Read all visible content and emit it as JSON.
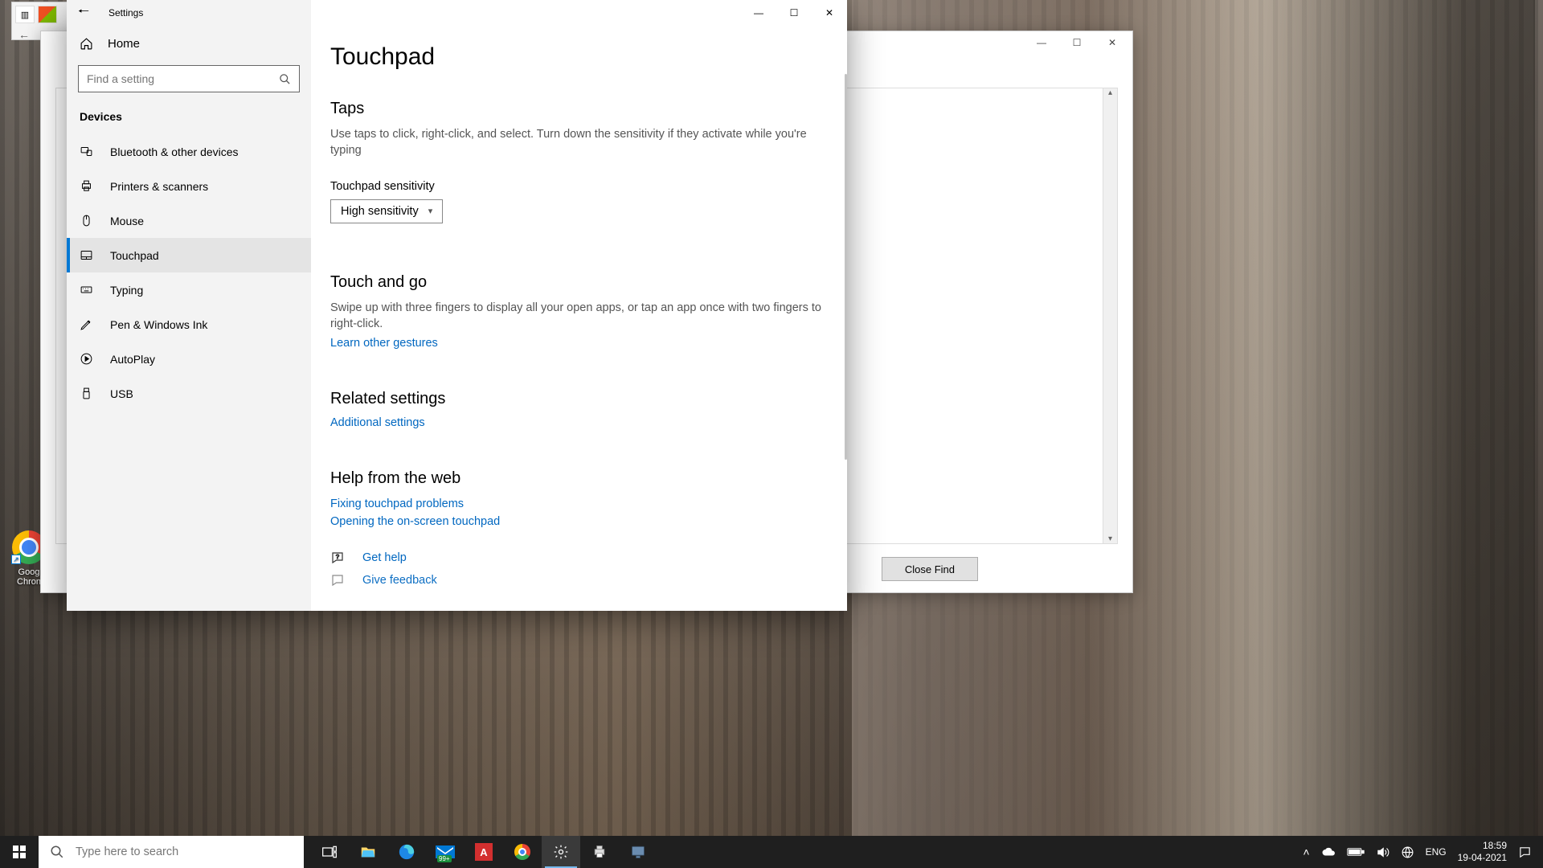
{
  "desktop": {
    "chrome_label_1": "Goog",
    "chrome_label_2": "Chron"
  },
  "bg_window": {
    "close_find": "Close Find"
  },
  "settings": {
    "title": "Settings",
    "home": "Home",
    "search_placeholder": "Find a setting",
    "section": "Devices",
    "items": [
      {
        "label": "Bluetooth & other devices"
      },
      {
        "label": "Printers & scanners"
      },
      {
        "label": "Mouse"
      },
      {
        "label": "Touchpad"
      },
      {
        "label": "Typing"
      },
      {
        "label": "Pen & Windows Ink"
      },
      {
        "label": "AutoPlay"
      },
      {
        "label": "USB"
      }
    ],
    "page": {
      "title": "Touchpad",
      "taps_h": "Taps",
      "taps_p": "Use taps to click, right-click, and select. Turn down the sensitivity if they activate while you're typing",
      "sensitivity_label": "Touchpad sensitivity",
      "sensitivity_value": "High sensitivity",
      "touchgo_h": "Touch and go",
      "touchgo_p": "Swipe up with three fingers to display all your open apps, or tap an app once with two fingers to right-click.",
      "learn_link": "Learn other gestures",
      "related_h": "Related settings",
      "additional_link": "Additional settings",
      "help_h": "Help from the web",
      "help_link_1": "Fixing touchpad problems",
      "help_link_2": "Opening the on-screen touchpad",
      "get_help": "Get help",
      "give_feedback": "Give feedback"
    }
  },
  "taskbar": {
    "search_placeholder": "Type here to search",
    "lang": "ENG",
    "mail_badge": "99+",
    "time": "18:59",
    "date": "19-04-2021"
  }
}
